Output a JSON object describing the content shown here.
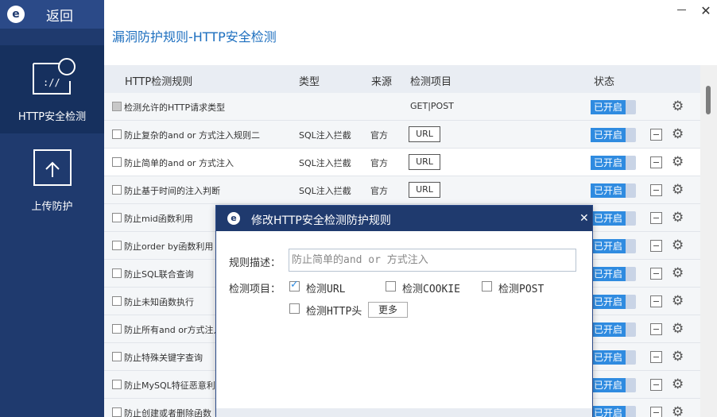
{
  "sidebar": {
    "back_label": "返回",
    "nav": [
      {
        "label": "HTTP安全检测",
        "icon": "http-shield-icon"
      },
      {
        "label": "上传防护",
        "icon": "upload-icon"
      }
    ]
  },
  "header": {
    "title": "漏洞防护规则-HTTP安全检测"
  },
  "table": {
    "headers": [
      "HTTP检测规则",
      "类型",
      "来源",
      "检测项目",
      "状态"
    ],
    "rows": [
      {
        "name": "检测允许的HTTP请求类型",
        "type": "",
        "source": "",
        "item": "GET|POST",
        "status": "已开启"
      },
      {
        "name": "防止复杂的and or 方式注入规则二",
        "type": "SQL注入拦截",
        "source": "官方",
        "item": "URL",
        "status": "已开启"
      },
      {
        "name": "防止简单的and or 方式注入",
        "type": "SQL注入拦截",
        "source": "官方",
        "item": "URL",
        "status": "已开启"
      },
      {
        "name": "防止基于时间的注入判断",
        "type": "SQL注入拦截",
        "source": "官方",
        "item": "URL",
        "status": "已开启"
      },
      {
        "name": "防止mid函数利用",
        "type": "",
        "source": "",
        "item": "",
        "status": "已开启"
      },
      {
        "name": "防止order by函数利用",
        "type": "",
        "source": "",
        "item": "",
        "status": "已开启"
      },
      {
        "name": "防止SQL联合查询",
        "type": "",
        "source": "",
        "item": "",
        "status": "已开启"
      },
      {
        "name": "防止未知函数执行",
        "type": "",
        "source": "",
        "item": "",
        "status": "已开启"
      },
      {
        "name": "防止所有and or方式注入",
        "type": "",
        "source": "",
        "item": "",
        "status": "已开启"
      },
      {
        "name": "防止特殊关键字查询",
        "type": "",
        "source": "",
        "item": "",
        "status": "已开启"
      },
      {
        "name": "防止MySQL特征恶意利",
        "type": "",
        "source": "",
        "item": "",
        "status": "已开启"
      },
      {
        "name": "防止创建或者删除函数",
        "type": "",
        "source": "",
        "item": "",
        "status": "已开启"
      }
    ]
  },
  "dialog": {
    "title": "修改HTTP安全检测防护规则",
    "desc_label": "规则描述：",
    "desc_value": "防止简单的and or 方式注入",
    "items_label": "检测项目：",
    "options": [
      {
        "label": "检测URL",
        "checked": true
      },
      {
        "label": "检测COOKIE",
        "checked": false
      },
      {
        "label": "检测POST",
        "checked": false
      },
      {
        "label": "检测HTTP头",
        "checked": false
      }
    ],
    "more_label": "更多"
  },
  "colors": {
    "sidebar": "#1f3a6e",
    "accent": "#2f8be0",
    "title": "#1d6fbf"
  }
}
